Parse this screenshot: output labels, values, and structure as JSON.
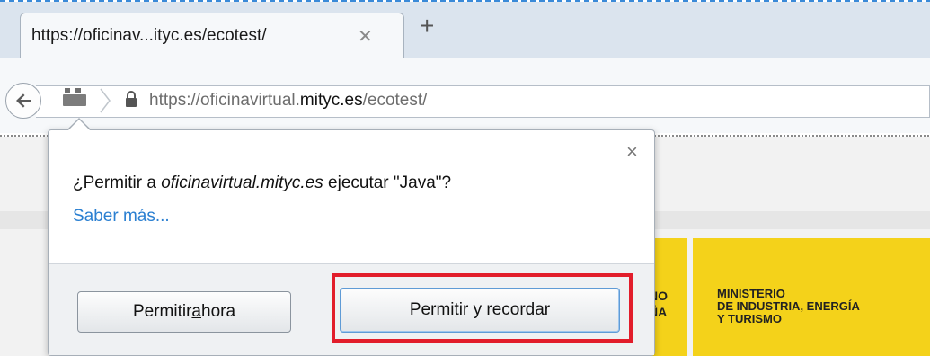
{
  "browser": {
    "tab": {
      "title": "https://oficinav...ityc.es/ecotest/",
      "close_icon": "close-icon"
    },
    "new_tab_label": "+",
    "urlbar": {
      "scheme": "https://oficinavirtual.",
      "domain": "mityc.es",
      "path": "/ecotest/"
    }
  },
  "doorhanger": {
    "message_prefix": "¿Permitir a ",
    "message_site": "oficinavirtual.mityc.es",
    "message_suffix": " ejecutar \"Java\"?",
    "learn_more": "Saber más...",
    "close_label": "×",
    "buttons": {
      "allow_now_pre": "Permitir ",
      "allow_now_key": "a",
      "allow_now_post": "hora",
      "allow_remember_key": "P",
      "allow_remember_post": "ermitir y recordar"
    }
  },
  "page": {
    "gov_fragment_line1": "NO",
    "gov_fragment_line2": "ÑA",
    "ministry_line1": "MINISTERIO",
    "ministry_line2": "DE INDUSTRIA, ENERGÍA",
    "ministry_line3": "Y TURISMO",
    "brand_yellow": "#f4d21a"
  },
  "colors": {
    "highlight": "#e21d2b",
    "link": "#2a7fd1"
  }
}
